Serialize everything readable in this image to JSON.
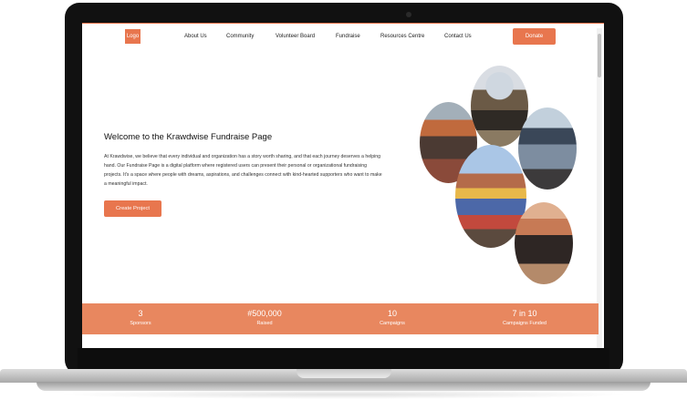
{
  "nav": {
    "logo": "Logo",
    "links": [
      "About Us",
      "Community",
      "Volunteer Board",
      "Fundraise",
      "Resources Centre",
      "Contact Us"
    ],
    "donate_label": "Donate"
  },
  "hero": {
    "title": "Welcome to the Krawdwise Fundraise Page",
    "body": "At Krawdwise, we believe that every individual and organization has a story worth sharing, and that each journey deserves a helping hand. Our Fundraise Page is a digital platform where registered users can present their personal or organizational fundraising projects. It's a space where people with dreams, aspirations, and challenges connect with kind-hearted supporters who want to make a meaningful impact.",
    "cta_label": "Create Project"
  },
  "stats": [
    {
      "value": "3",
      "label": "Sponsors"
    },
    {
      "value": "#500,000",
      "label": "Raised"
    },
    {
      "value": "10",
      "label": "Campaigns"
    },
    {
      "value": "7 in 10",
      "label": "Campaigns Funded"
    }
  ]
}
